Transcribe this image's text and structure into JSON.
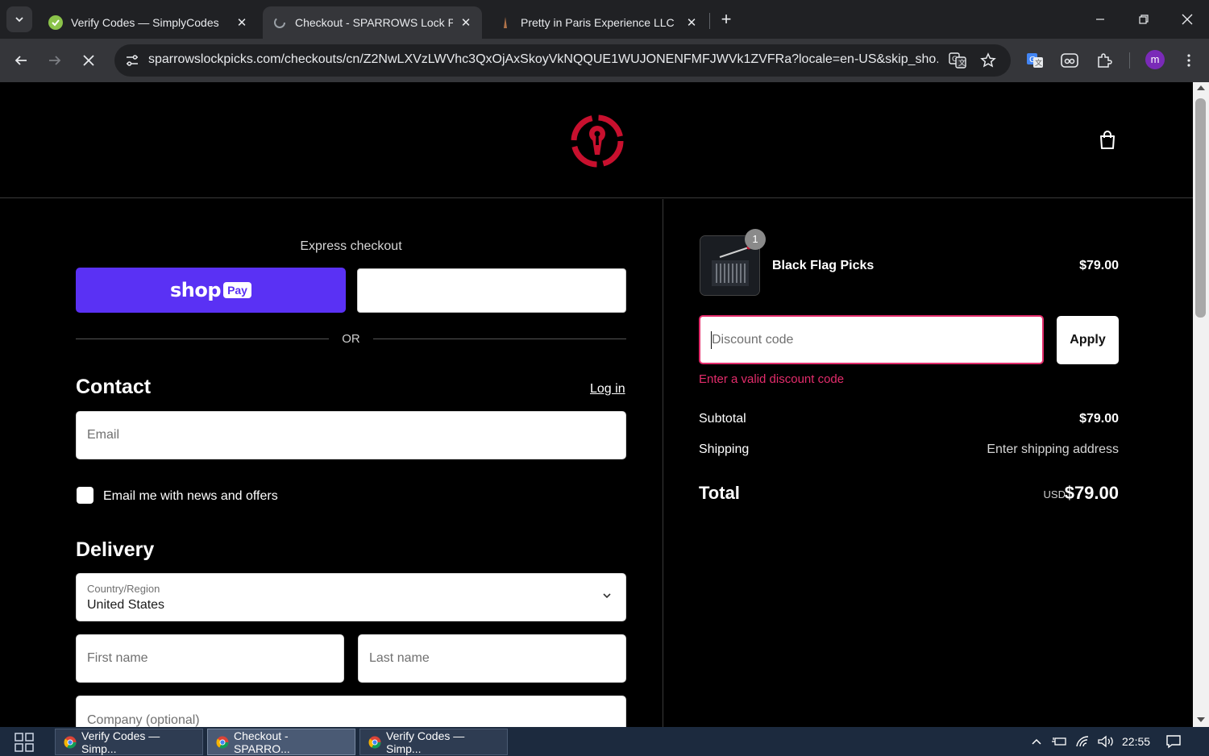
{
  "browser": {
    "tabs": [
      {
        "title": "Verify Codes — SimplyCodes",
        "active": false
      },
      {
        "title": "Checkout - SPARROWS Lock Pic",
        "active": true
      },
      {
        "title": "Pretty in Paris Experience LLC",
        "active": false
      }
    ],
    "url": "sparrowslockpicks.com/checkouts/cn/Z2NwLXVzLWVhc3QxOjAxSkoyVkNQQUE1WUJONENFMFJWVk1ZVFRa?locale=en-US&skip_sho...",
    "profile_initial": "m"
  },
  "checkout": {
    "express_label": "Express checkout",
    "shop_pay": {
      "word": "shop",
      "badge": "Pay"
    },
    "or_label": "OR",
    "contact_title": "Contact",
    "login_label": "Log in",
    "email_placeholder": "Email",
    "newsletter_label": "Email me with news and offers",
    "delivery_title": "Delivery",
    "country_label": "Country/Region",
    "country_value": "United States",
    "first_name_placeholder": "First name",
    "last_name_placeholder": "Last name",
    "company_placeholder": "Company (optional)"
  },
  "summary": {
    "item": {
      "name": "Black Flag Picks",
      "price": "$79.00",
      "quantity": "1"
    },
    "discount_placeholder": "Discount code",
    "apply_label": "Apply",
    "discount_error": "Enter a valid discount code",
    "subtotal_label": "Subtotal",
    "subtotal_value": "$79.00",
    "shipping_label": "Shipping",
    "shipping_value": "Enter shipping address",
    "total_label": "Total",
    "total_currency": "USD",
    "total_value": "$79.00"
  },
  "taskbar": {
    "items": [
      {
        "label": "Verify Codes — Simp...",
        "active": false
      },
      {
        "label": "Checkout - SPARRO...",
        "active": true
      },
      {
        "label": "Verify Codes — Simp...",
        "active": false
      }
    ],
    "clock": "22:55"
  },
  "colors": {
    "shop_pay": "#5a31f4",
    "error": "#e32c6b",
    "logo_red": "#c8102e"
  }
}
